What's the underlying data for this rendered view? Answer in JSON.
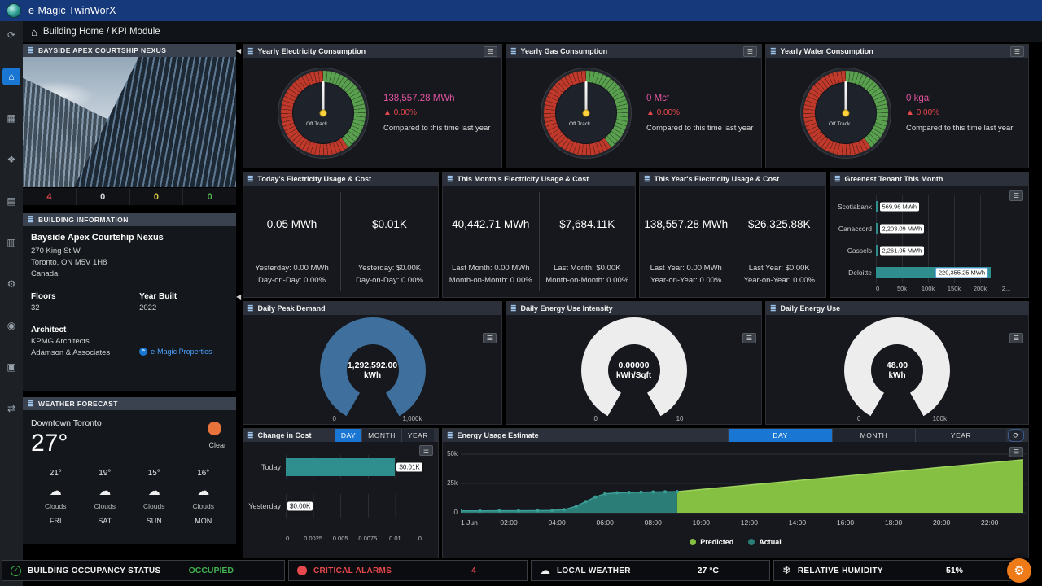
{
  "app": {
    "title": "e-Magic TwinWorX"
  },
  "breadcrumb": {
    "text": "Building Home / KPI Module"
  },
  "icons": {
    "panel": "≣",
    "menu": "☰",
    "home": "⌂",
    "cloud": "☁",
    "gear": "⚙",
    "check": "✓",
    "humidity": "❄",
    "refresh": "⟳",
    "up": "▲",
    "collapse": "◀",
    "link_dot": "e"
  },
  "colors": {
    "accent_blue": "#1976d2",
    "teal_bar": "#2f8f8f",
    "donut_fill": "#3f6f9c",
    "pink_value": "#e255a1",
    "delta_red": "#e5484d",
    "predicted_green": "#86c042",
    "actual_teal": "#2b7d78",
    "occupied_green": "#3faf4f",
    "fab_orange": "#ee7b18"
  },
  "sidebar": {
    "items": [
      {
        "name": "account",
        "glyph": "⟳",
        "active": false
      },
      {
        "name": "home",
        "glyph": "⌂",
        "active": true
      },
      {
        "name": "buildings",
        "glyph": "▦",
        "active": false
      },
      {
        "name": "integrations",
        "glyph": "❖",
        "active": false
      },
      {
        "name": "tasks",
        "glyph": "▤",
        "active": false
      },
      {
        "name": "analytics",
        "glyph": "▥",
        "active": false
      },
      {
        "name": "settings",
        "glyph": "⚙",
        "active": false
      },
      {
        "name": "alarms",
        "glyph": "◉",
        "active": false
      },
      {
        "name": "schedule",
        "glyph": "▣",
        "active": false
      },
      {
        "name": "reports",
        "glyph": "⇄",
        "active": false
      }
    ]
  },
  "building_card": {
    "header": "BAYSIDE APEX COURTSHIP NEXUS",
    "counts": [
      {
        "value": "4",
        "color": "#e5484d"
      },
      {
        "value": "0",
        "color": "#d8d8d8"
      },
      {
        "value": "0",
        "color": "#d8c84a"
      },
      {
        "value": "0",
        "color": "#52b24c"
      }
    ]
  },
  "building_info": {
    "header": "BUILDING INFORMATION",
    "name": "Bayside Apex Courtship Nexus",
    "address1": "270 King St W",
    "address2": "Toronto, ON M5V 1H8",
    "country": "Canada",
    "floors_label": "Floors",
    "floors_value": "32",
    "year_built_label": "Year Built",
    "year_built_value": "2022",
    "architect_label": "Architect",
    "architect_line1": "KPMG Architects",
    "architect_line2": "Adamson & Associates",
    "link_label": "e-Magic Properties"
  },
  "weather": {
    "header": "WEATHER FORECAST",
    "location": "Downtown Toronto",
    "temp": "27°",
    "condition": "Clear",
    "forecast": [
      {
        "temp": "21°",
        "condition": "Clouds",
        "day": "FRI"
      },
      {
        "temp": "19°",
        "condition": "Clouds",
        "day": "SAT"
      },
      {
        "temp": "15°",
        "condition": "Clouds",
        "day": "SUN"
      },
      {
        "temp": "16°",
        "condition": "Clouds",
        "day": "MON"
      }
    ]
  },
  "gauges": [
    {
      "title": "Yearly Electricity Consumption",
      "status": "Off Track",
      "value": "138,557.28 MWh",
      "delta": "0.00%",
      "note": "Compared to this time last year"
    },
    {
      "title": "Yearly Gas Consumption",
      "status": "Off Track",
      "value": "0 Mcf",
      "delta": "0.00%",
      "note": "Compared to this time last year"
    },
    {
      "title": "Yearly Water Consumption",
      "status": "Off Track",
      "value": "0 kgal",
      "delta": "0.00%",
      "note": "Compared to this time last year"
    }
  ],
  "usage_panels": [
    {
      "title": "Today's Electricity Usage & Cost",
      "usage_value": "0.05 MWh",
      "usage_line1": "Yesterday: 0.00 MWh",
      "usage_line2": "Day-on-Day: 0.00%",
      "cost_value": "$0.01K",
      "cost_line1": "Yesterday: $0.00K",
      "cost_line2": "Day-on-Day: 0.00%"
    },
    {
      "title": "This Month's Electricity Usage & Cost",
      "usage_value": "40,442.71 MWh",
      "usage_line1": "Last Month: 0.00 MWh",
      "usage_line2": "Month-on-Month: 0.00%",
      "cost_value": "$7,684.11K",
      "cost_line1": "Last Month: $0.00K",
      "cost_line2": "Month-on-Month: 0.00%"
    },
    {
      "title": "This Year's Electricity Usage & Cost",
      "usage_value": "138,557.28 MWh",
      "usage_line1": "Last Year: 0.00 MWh",
      "usage_line2": "Year-on-Year: 0.00%",
      "cost_value": "$26,325.88K",
      "cost_line1": "Last Year: $0.00K",
      "cost_line2": "Year-on-Year: 0.00%"
    }
  ],
  "greenest": {
    "title": "Greenest Tenant This Month",
    "chart": {
      "type": "bar",
      "orientation": "horizontal",
      "categories": [
        "Scotiabank",
        "Canaccord",
        "Cassels",
        "Deloitte"
      ],
      "values": [
        569.96,
        2203.09,
        2261.05,
        220355.25
      ],
      "labels": [
        "569.96 MWh",
        "2,203.09 MWh",
        "2,261.05 MWh",
        "220,355.25 MWh"
      ],
      "xmax": 250000,
      "xtick_values": [
        0,
        50000,
        100000,
        150000,
        200000,
        250000
      ],
      "xticks": [
        "0",
        "50k",
        "100k",
        "150k",
        "200k",
        "2..."
      ]
    }
  },
  "donut_gauges": [
    {
      "title": "Daily Peak Demand",
      "value": "1,292,592.00",
      "unit": "kWh",
      "min": "0",
      "max": "1,000k",
      "fill_fraction": 1
    },
    {
      "title": "Daily Energy Use Intensity",
      "value": "0.00000",
      "unit": "kWh/Sqft",
      "min": "0",
      "max": "10",
      "fill_fraction": 0
    },
    {
      "title": "Daily Energy Use",
      "value": "48.00",
      "unit": "kWh",
      "min": "0",
      "max": "100k",
      "fill_fraction": 0.0005
    }
  ],
  "change_in_cost": {
    "title": "Change in Cost",
    "tabs": [
      "DAY",
      "MONTH",
      "YEAR"
    ],
    "active_tab": "DAY",
    "chart": {
      "type": "bar",
      "orientation": "horizontal",
      "categories": [
        "Today",
        "Yesterday"
      ],
      "values": [
        0.01,
        0
      ],
      "labels": [
        "$0.01K",
        "$0.00K"
      ],
      "xmax": 0.0125,
      "xtick_values": [
        0,
        0.0025,
        0.005,
        0.0075,
        0.01,
        0.0125
      ],
      "xticks": [
        "0",
        "0.0025",
        "0.005",
        "0.0075",
        "0.01",
        "0..."
      ]
    }
  },
  "energy_estimate": {
    "title": "Energy Usage Estimate",
    "tabs": [
      "DAY",
      "MONTH",
      "YEAR"
    ],
    "active_tab": "DAY",
    "legend": [
      "Predicted",
      "Actual"
    ],
    "chart": {
      "type": "area",
      "ymax": 50000,
      "ygrid_values": [
        0,
        25000,
        50000
      ],
      "yticks": [
        "0",
        "25k",
        "50k"
      ],
      "x_range": [
        0,
        23.5
      ],
      "xtick_hours": [
        0,
        2,
        4,
        6,
        8,
        10,
        12,
        14,
        16,
        18,
        20,
        22
      ],
      "xticks": [
        "1 Jun",
        "02:00",
        "04:00",
        "06:00",
        "08:00",
        "10:00",
        "12:00",
        "14:00",
        "16:00",
        "18:00",
        "20:00",
        "22:00"
      ],
      "series": [
        {
          "name": "Predicted",
          "color": "#86c042",
          "line": "#9ed45e",
          "dots": false,
          "x": [
            9.0,
            23.4
          ],
          "y": [
            18000,
            45200
          ]
        },
        {
          "name": "Actual",
          "color": "#2b7d78",
          "line": "#3a9e96",
          "dots": true,
          "x": [
            0,
            0.8,
            1.6,
            2.4,
            3.2,
            3.8,
            4.3,
            4.8,
            5.2,
            5.6,
            6.0,
            6.5,
            7.0,
            7.5,
            8.0,
            8.5,
            9.0
          ],
          "y": [
            1600,
            1600,
            1650,
            1700,
            1750,
            1900,
            2600,
            5500,
            9500,
            13500,
            16200,
            17000,
            17300,
            17500,
            17700,
            17900,
            18000
          ]
        }
      ]
    }
  },
  "status_bar": [
    {
      "icon": "check-circle",
      "label": "BUILDING OCCUPANCY STATUS",
      "value": "OCCUPIED",
      "label_color": "#f2f2f2",
      "value_color": "#3faf4f"
    },
    {
      "icon": "alarm-dot",
      "label": "CRITICAL ALARMS",
      "value": "4",
      "label_color": "#e5484d",
      "value_color": "#e5484d"
    },
    {
      "icon": "weather-cloud",
      "label": "LOCAL WEATHER",
      "value": "27 °C",
      "label_color": "#f2f2f2",
      "value_color": "#ffffff"
    },
    {
      "icon": "humidity",
      "label": "RELATIVE HUMIDITY",
      "value": "51%",
      "label_color": "#f2f2f2",
      "value_color": "#ffffff"
    }
  ]
}
